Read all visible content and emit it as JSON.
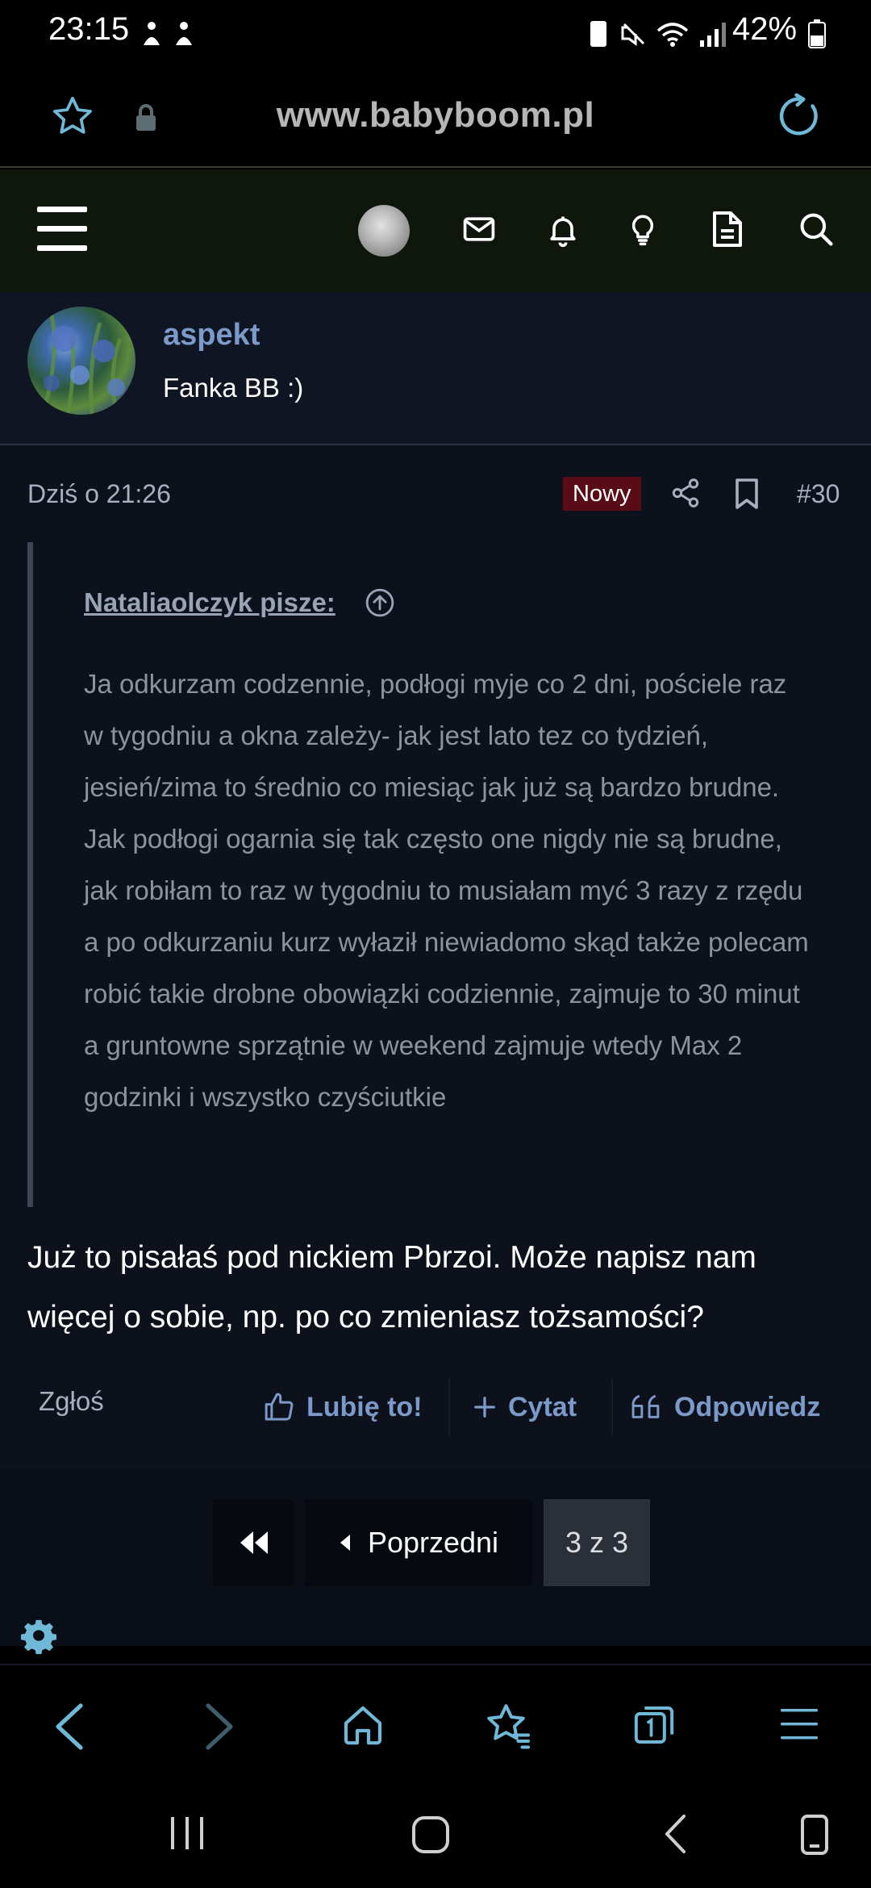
{
  "status_bar": {
    "time": "23:15",
    "battery": "42%"
  },
  "browser": {
    "url": "www.babyboom.pl"
  },
  "author": {
    "name": "aspekt",
    "title": "Fanka BB :)"
  },
  "post": {
    "date": "Dziś o 21:26",
    "badge": "Nowy",
    "number": "#30",
    "quote_author": "Nataliaolczyk pisze:",
    "quote_text": "Ja odkurzam codzennie, podłogi myje co 2 dni, pościele raz w tygodniu a okna zależy- jak jest lato tez co tydzień, jesień/zima to średnio co miesiąc jak już są bardzo brudne. Jak podłogi ogarnia się tak często one nigdy nie są brudne, jak robiłam to raz w tygodniu to musiałam myć 3 razy z rzędu a po odkurzaniu kurz wyłaził niewiadomo skąd także polecam robić takie drobne obowiązki codziennie, zajmuje to 30 minut a gruntowne sprzątnie w weekend zajmuje wtedy Max 2 godzinki i wszystko czyściutkie",
    "body": "Już to pisałaś pod nickiem Pbrzoi. Może napisz nam więcej o sobie, np. po co zmieniasz tożsamości?",
    "actions": {
      "report": "Zgłoś",
      "like": "Lubię to!",
      "quote": "Cytat",
      "reply": "Odpowiedz"
    }
  },
  "pagination": {
    "previous": "Poprzedni",
    "current": "3 z 3"
  },
  "colors": {
    "accent": "#7b99c9",
    "browser_icon": "#6fb8d8",
    "badge_bg": "#5a0c16"
  }
}
